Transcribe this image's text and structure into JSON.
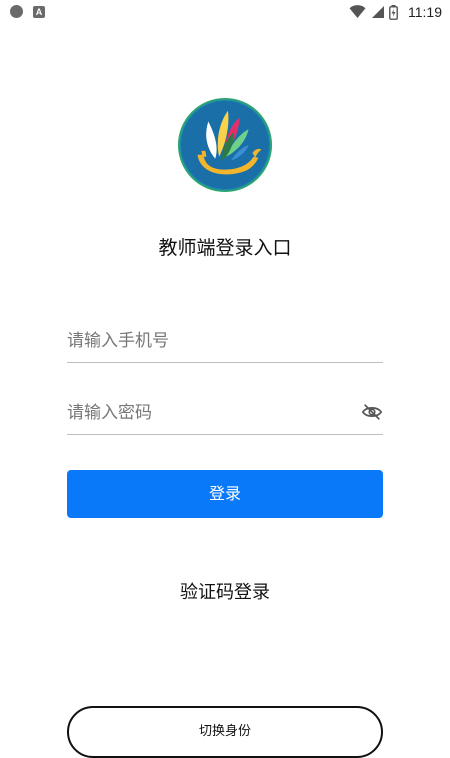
{
  "status_bar": {
    "time": "11:19",
    "icons": [
      "notification-dot-icon",
      "a-icon",
      "wifi-icon",
      "signal-icon",
      "battery-icon"
    ]
  },
  "logo": {
    "icon": "school-logo-icon",
    "colors": {
      "background": "#1a6fa8",
      "border": "#2aa56f",
      "boat": "#f2b52c",
      "leaves": [
        "#e0306a",
        "#6fd08c",
        "#f7d24a",
        "#ffffff",
        "#2d7a44"
      ]
    }
  },
  "title": "教师端登录入口",
  "form": {
    "phone_placeholder": "请输入手机号",
    "password_placeholder": "请输入密码",
    "password_toggle_icon": "eye-off-icon"
  },
  "buttons": {
    "login": "登录",
    "code_login": "验证码登录",
    "switch_identity": "切换身份"
  },
  "colors": {
    "primary": "#0a79f9",
    "text": "#111111",
    "divider": "#bdbdbd"
  }
}
